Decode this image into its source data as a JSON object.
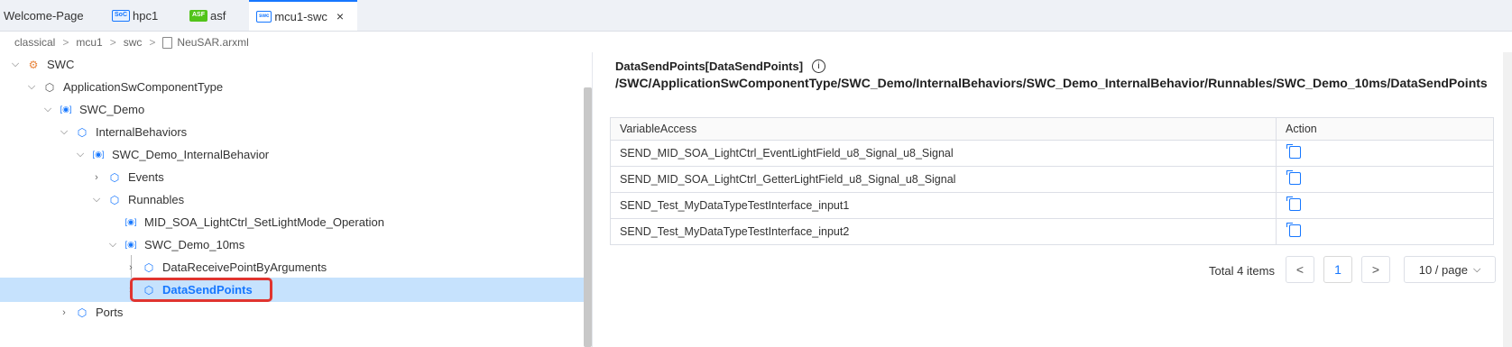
{
  "tabs": [
    {
      "label": "Welcome-Page",
      "badge": ""
    },
    {
      "label": "hpc1",
      "badge": "SoC"
    },
    {
      "label": "asf",
      "badge": "ASF"
    },
    {
      "label": "mcu1-swc",
      "badge": "swc",
      "close": "×"
    }
  ],
  "breadcrumb": {
    "items": [
      "classical",
      "mcu1",
      "swc"
    ],
    "file": "NeuSAR.arxml",
    "separator": ">"
  },
  "tree": [
    {
      "label": "SWC",
      "caret": "⌵",
      "icon": "⚙"
    },
    {
      "label": "ApplicationSwComponentType",
      "caret": "⌵",
      "icon": "⬡"
    },
    {
      "label": "SWC_Demo",
      "caret": "⌵",
      "icon": "[◉]"
    },
    {
      "label": "InternalBehaviors",
      "caret": "⌵",
      "icon": "⬡"
    },
    {
      "label": "SWC_Demo_InternalBehavior",
      "caret": "⌵",
      "icon": "[◉]"
    },
    {
      "label": "Events",
      "caret": "›",
      "icon": "⬡"
    },
    {
      "label": "Runnables",
      "caret": "⌵",
      "icon": "⬡"
    },
    {
      "label": "MID_SOA_LightCtrl_SetLightMode_Operation",
      "caret": "",
      "icon": "[◉]"
    },
    {
      "label": "SWC_Demo_10ms",
      "caret": "⌵",
      "icon": "[◉]"
    },
    {
      "label": "DataReceivePointByArguments",
      "caret": "›",
      "icon": "⬡"
    },
    {
      "label": "DataSendPoints",
      "caret": "›",
      "icon": "⬡"
    },
    {
      "label": "Ports",
      "caret": "›",
      "icon": "⬡"
    }
  ],
  "detail": {
    "title": "DataSendPoints[DataSendPoints]",
    "info_icon": "i",
    "path": "/SWC/ApplicationSwComponentType/SWC_Demo/InternalBehaviors/SWC_Demo_InternalBehavior/Runnables/SWC_Demo_10ms/DataSendPoints"
  },
  "table": {
    "headers": [
      "VariableAccess",
      "Action"
    ],
    "rows": [
      "SEND_MID_SOA_LightCtrl_EventLightField_u8_Signal_u8_Signal",
      "SEND_MID_SOA_LightCtrl_GetterLightField_u8_Signal_u8_Signal",
      "SEND_Test_MyDataTypeTestInterface_input1",
      "SEND_Test_MyDataTypeTestInterface_input2"
    ]
  },
  "pagination": {
    "total": "Total 4 items",
    "prev": "<",
    "page": "1",
    "next": ">",
    "page_size": "10 / page",
    "page_size_caret": "⌵"
  },
  "colors": {
    "accent": "#1677ff",
    "selected_bg": "#c6e2fd",
    "highlight_border": "#e0342f"
  }
}
